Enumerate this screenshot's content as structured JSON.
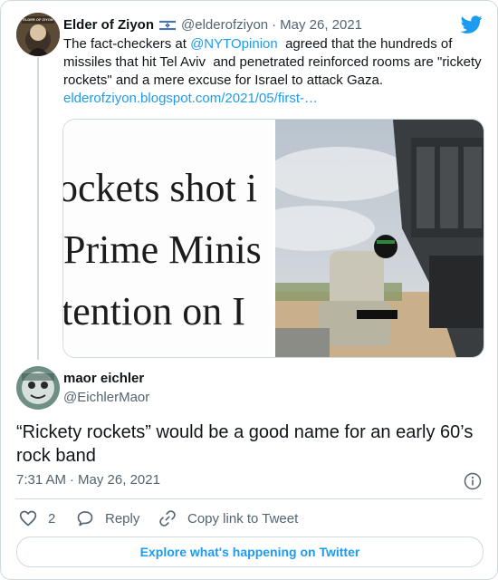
{
  "parent_tweet": {
    "author_name": "Elder of Ziyon",
    "handle": "@elderofziyon",
    "separator": "·",
    "date": "May 26, 2021",
    "text_before_mention": "The fact-checkers at ",
    "mention": "@NYTOpinion",
    "text_after_mention": "  agreed that the hundreds of missiles that hit Tel Aviv  and penetrated reinforced rooms are \"rickety rockets\" and a mere excuse for Israel to attack Gaza.",
    "link": "elderofziyon.blogspot.com/2021/05/first-…",
    "avatar_badge": "ELDER OF ZIYON",
    "flag_icon": "israel-flag-icon",
    "media": {
      "crop_lines": [
        "ockets shot i",
        "Prime Minis",
        "tention on I"
      ]
    }
  },
  "main_tweet": {
    "author_name": "maor eichler",
    "handle": "@EichlerMaor",
    "text": "“Rickety rockets” would be a good name for an early 60’s rock band",
    "time": "7:31 AM",
    "separator": "·",
    "date": "May 26, 2021"
  },
  "actions": {
    "like_count": "2",
    "reply_label": "Reply",
    "copy_label": "Copy link to Tweet"
  },
  "explore_label": "Explore what's happening on Twitter",
  "icons": {
    "brand": "twitter-bird-icon",
    "info": "info-icon",
    "like": "heart-icon",
    "reply": "speech-bubble-icon",
    "copy": "link-icon"
  },
  "colors": {
    "accent": "#1d9bf0",
    "muted": "#536471",
    "border": "#cfd9de",
    "text": "#0f1419"
  }
}
